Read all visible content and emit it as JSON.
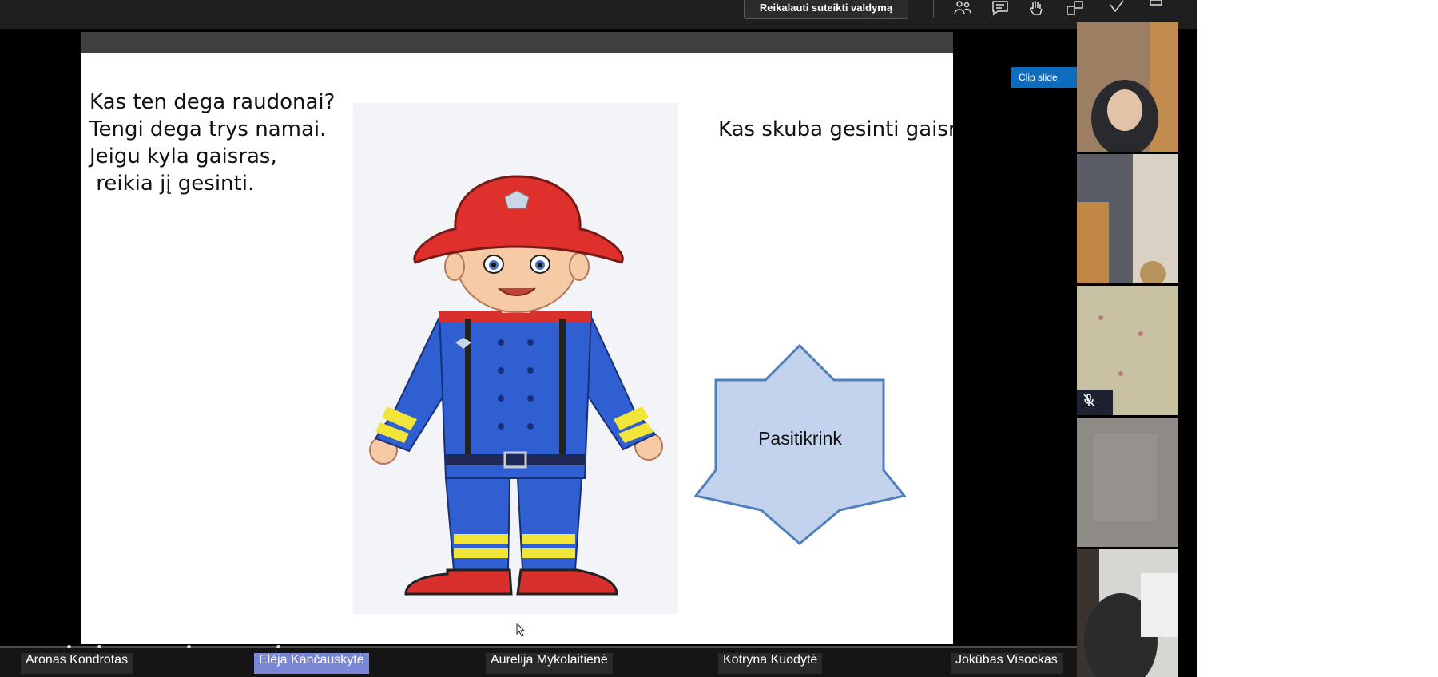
{
  "toolbar": {
    "request_control_label": "Reikalauti suteikti valdymą",
    "icons": [
      "people-icon",
      "chat-icon",
      "raise-hand-icon",
      "rooms-icon",
      "reactions-icon",
      "more-icon"
    ]
  },
  "slide": {
    "poem_lines": [
      "Kas ten dega raudonai?",
      "Tengi dega trys namai.",
      "Jeigu kyla gaisras,",
      " reikia jį gesinti."
    ],
    "question": "Kas skuba gesinti gaisrą",
    "star_button_label": "Pasitikrink"
  },
  "clip_slide_label": "Clip slide",
  "participants": [
    {
      "name": "Aronas Kondrotas"
    },
    {
      "name": "Eléja Kančauskytė"
    },
    {
      "name": "Aurelija Mykolaitienė"
    },
    {
      "name": "Kotryna Kuodytė"
    },
    {
      "name": "Jokūbas Visockas"
    }
  ],
  "colors": {
    "toolbar_bg": "#1f1f1f",
    "clip_slide_bg": "#0f6cbd",
    "active_participant_bg": "#7a86d6",
    "star_fill": "#c3d3ee",
    "star_stroke": "#4f80bd"
  }
}
